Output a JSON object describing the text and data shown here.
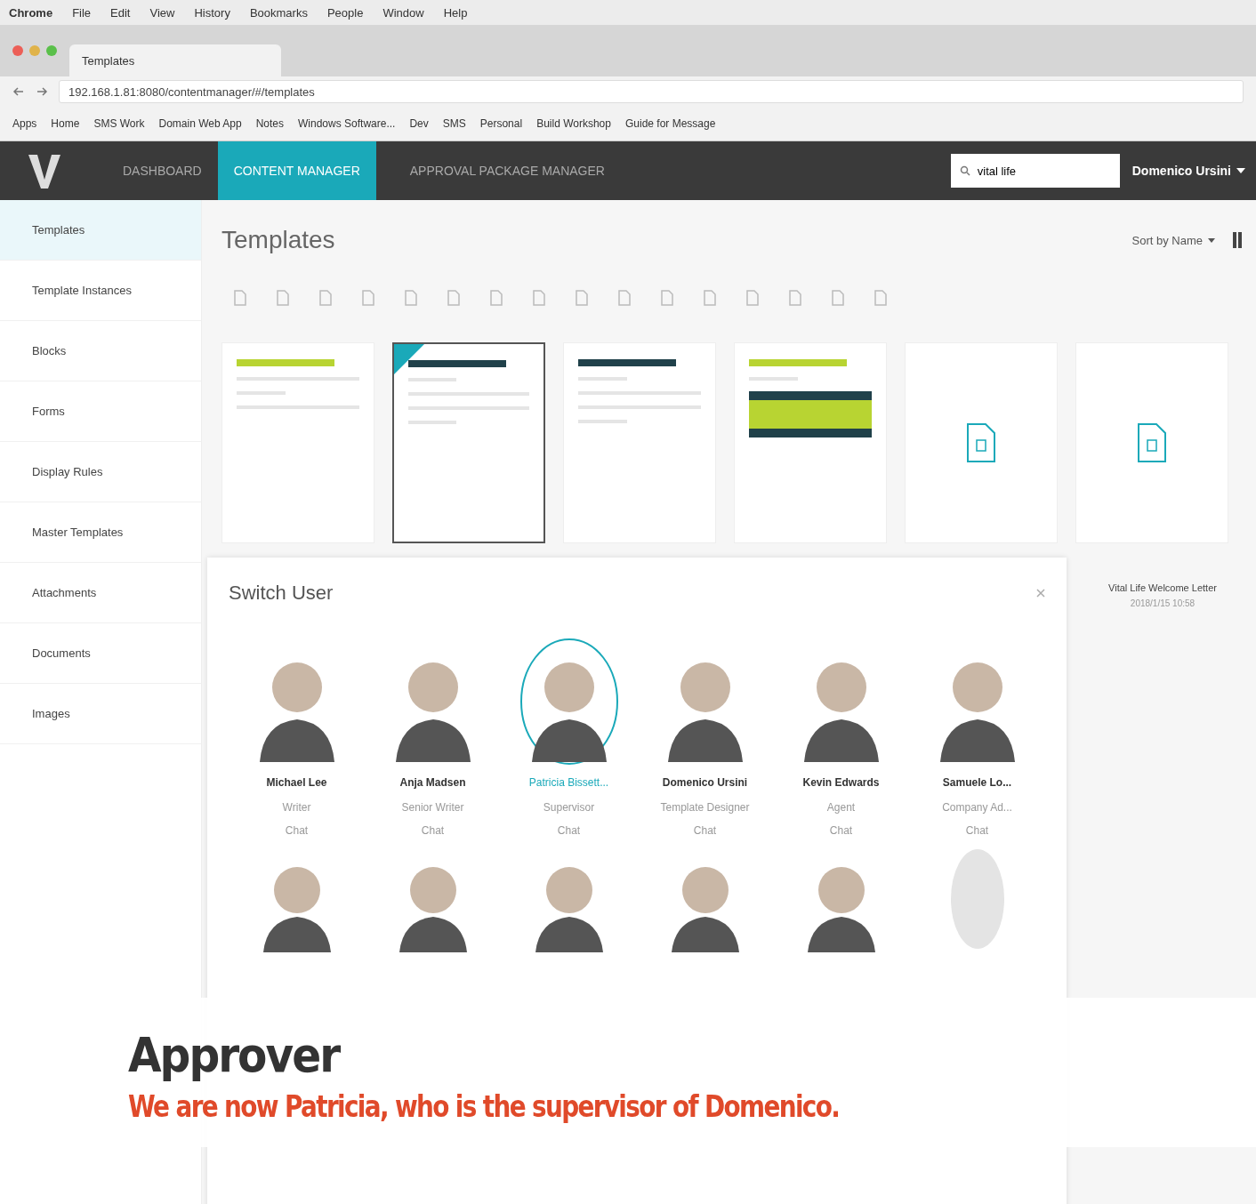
{
  "os_menu": {
    "items": [
      "Chrome",
      "File",
      "Edit",
      "View",
      "History",
      "Bookmarks",
      "People",
      "Window",
      "Help"
    ]
  },
  "browser": {
    "tab_title": "Templates",
    "url": "192.168.1.81:8080/contentmanager/#/templates",
    "bookmarks": [
      "Apps",
      "Home",
      "SMS Work",
      "Domain Web App",
      "Notes",
      "Windows Software...",
      "Dev",
      "SMS",
      "Personal",
      "Build Workshop",
      "Guide for Message"
    ]
  },
  "app": {
    "nav": [
      {
        "label": "DASHBOARD",
        "selected": false
      },
      {
        "label": "CONTENT MANAGER",
        "selected": true
      },
      {
        "label": "APPROVAL PACKAGE MANAGER",
        "selected": false
      }
    ],
    "search": {
      "value": "vital life"
    },
    "user": "Domenico Ursini"
  },
  "sidebar": {
    "items": [
      {
        "label": "Templates",
        "selected": true
      },
      {
        "label": "Template Instances",
        "selected": false
      },
      {
        "label": "Blocks",
        "selected": false
      },
      {
        "label": "Forms",
        "selected": false
      },
      {
        "label": "Display Rules",
        "selected": false
      },
      {
        "label": "Master Templates",
        "selected": false
      },
      {
        "label": "Attachments",
        "selected": false
      },
      {
        "label": "Documents",
        "selected": false
      },
      {
        "label": "Images",
        "selected": false
      }
    ]
  },
  "main": {
    "title": "Templates",
    "sort": "Sort by Name",
    "cards": [
      {
        "kind": "green-header",
        "selected": false
      },
      {
        "kind": "dark-header",
        "selected": true
      },
      {
        "kind": "dark-header",
        "selected": false
      },
      {
        "kind": "banded",
        "selected": false
      },
      {
        "kind": "blank",
        "selected": false
      },
      {
        "kind": "blank",
        "selected": false
      }
    ],
    "card_caption": {
      "title": "Vital Life Welcome Letter",
      "date": "2018/1/15 10:58"
    }
  },
  "switch_user": {
    "title": "Switch User",
    "users": [
      {
        "name": "Michael Lee",
        "role": "Writer",
        "action": "Chat",
        "selected": false
      },
      {
        "name": "Anja Madsen",
        "role": "Senior Writer",
        "action": "Chat",
        "selected": false
      },
      {
        "name": "Patricia Bissett...",
        "role": "Supervisor",
        "action": "Chat",
        "selected": true
      },
      {
        "name": "Domenico Ursini",
        "role": "Template Designer",
        "action": "Chat",
        "selected": false
      },
      {
        "name": "Kevin Edwards",
        "role": "Agent",
        "action": "Chat",
        "selected": false
      },
      {
        "name": "Samuele Lo...",
        "role": "Company Ad...",
        "action": "Chat",
        "selected": false
      }
    ],
    "more_users": [
      {
        "kind": "photo"
      },
      {
        "kind": "photo"
      },
      {
        "kind": "photo"
      },
      {
        "kind": "photo"
      },
      {
        "kind": "photo"
      },
      {
        "kind": "empty"
      }
    ]
  },
  "caption": {
    "title": "Approver",
    "text": "We are now Patricia, who is the supervisor of Domenico."
  }
}
